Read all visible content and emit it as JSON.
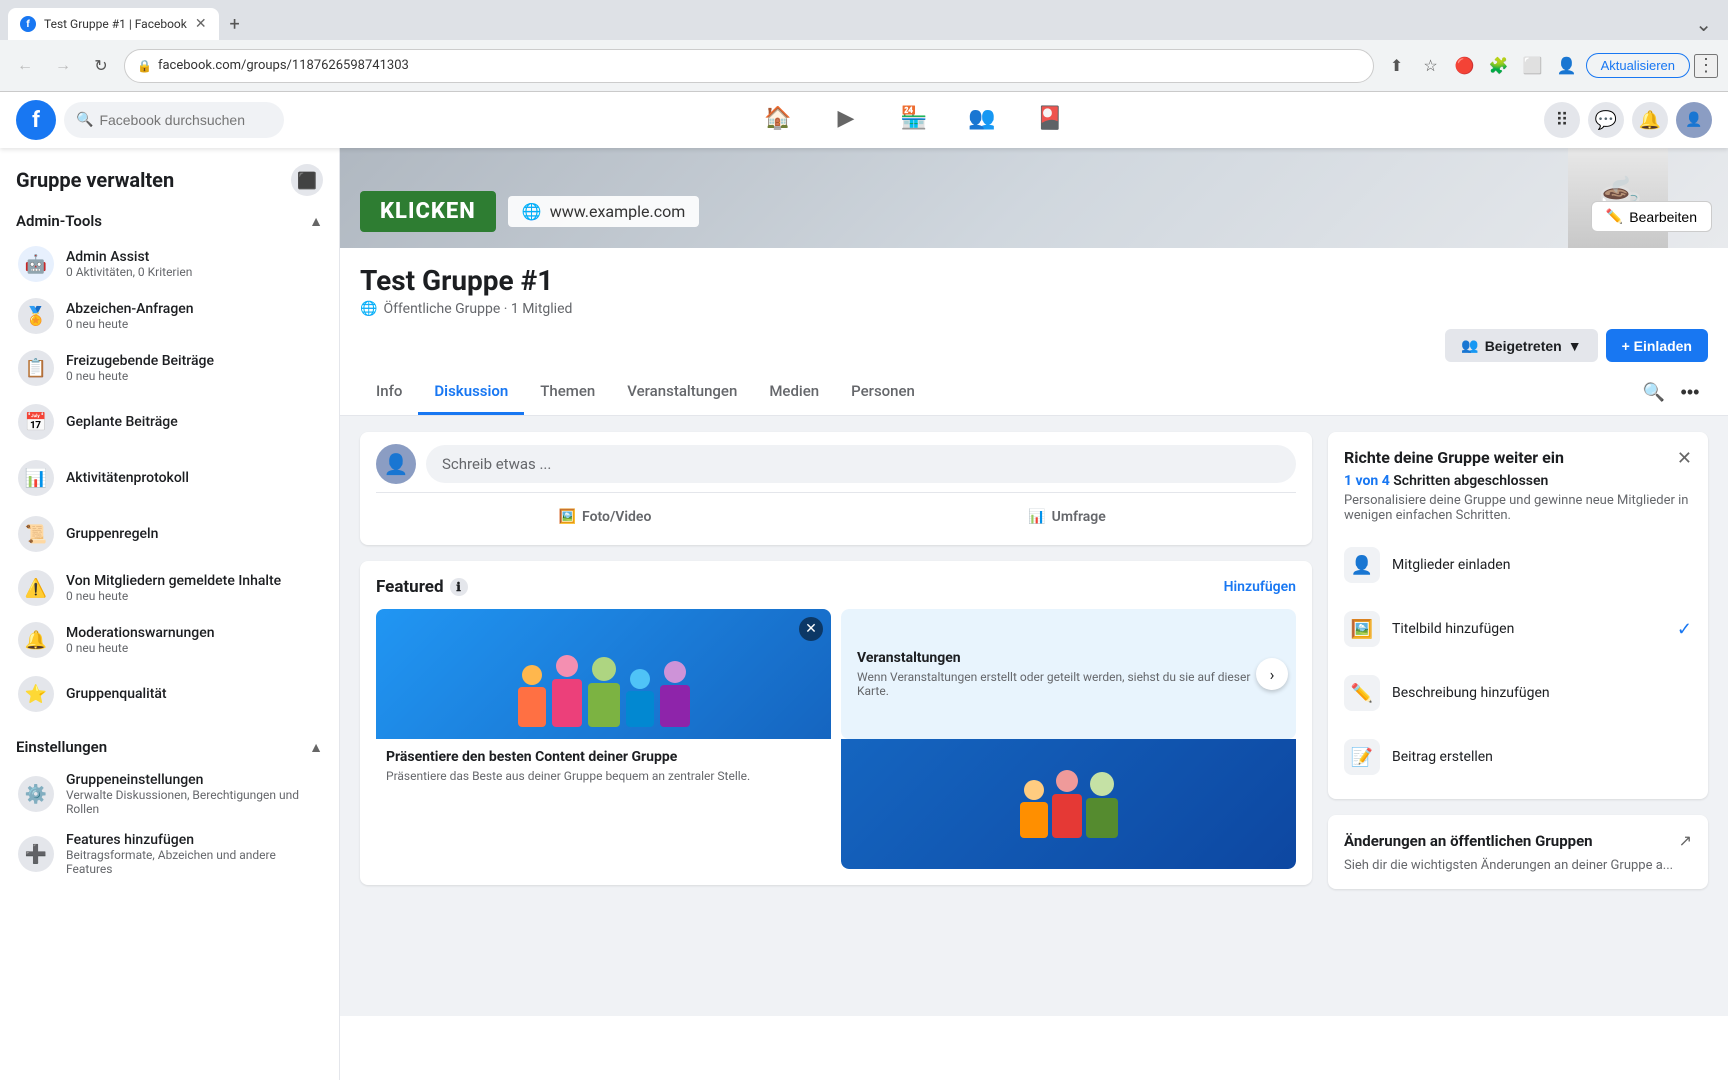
{
  "browser": {
    "tab_title": "Test Gruppe #1 | Facebook",
    "tab_favicon": "f",
    "address": "facebook.com/groups/11876265987413O3",
    "address_display": "facebook.com/groups/1187626598741303",
    "new_tab_label": "+",
    "update_btn_label": "Aktualisieren",
    "nav": {
      "back_disabled": true,
      "forward_disabled": true
    }
  },
  "fb_header": {
    "logo": "f",
    "search_placeholder": "Facebook durchsuchen",
    "nav_items": [
      "🏠",
      "▶",
      "🏪",
      "👥",
      "🎴"
    ],
    "avatar_icon": "👤"
  },
  "sidebar": {
    "title": "Gruppe verwalten",
    "admin_tools_label": "Admin-Tools",
    "items": [
      {
        "id": "admin-assist",
        "icon": "🤖",
        "title": "Admin Assist",
        "sub": "0 Aktivitäten, 0 Kriterien"
      },
      {
        "id": "abzeichen",
        "icon": "🏅",
        "title": "Abzeichen-Anfragen",
        "sub": "0 neu heute"
      },
      {
        "id": "freizugebende",
        "icon": "📋",
        "title": "Freizugebende Beiträge",
        "sub": "0 neu heute"
      },
      {
        "id": "geplante",
        "icon": "📅",
        "title": "Geplante Beiträge",
        "sub": ""
      },
      {
        "id": "aktivitaten",
        "icon": "📊",
        "title": "Aktivitätenprotokoll",
        "sub": ""
      },
      {
        "id": "gruppenregeln",
        "icon": "📜",
        "title": "Gruppenregeln",
        "sub": ""
      },
      {
        "id": "gemeldete",
        "icon": "⚠️",
        "title": "Von Mitgliedern gemeldete Inhalte",
        "sub": "0 neu heute"
      },
      {
        "id": "moderationswarnungen",
        "icon": "🔔",
        "title": "Moderationswarnungen",
        "sub": "0 neu heute"
      },
      {
        "id": "gruppenqualitat",
        "icon": "⭐",
        "title": "Gruppenqualität",
        "sub": ""
      }
    ],
    "einstellungen_label": "Einstellungen",
    "settings_items": [
      {
        "id": "gruppeneinstellungen",
        "icon": "⚙️",
        "title": "Gruppeneinstellungen",
        "sub": "Verwalte Diskussionen, Berechtigungen und Rollen"
      },
      {
        "id": "features",
        "icon": "➕",
        "title": "Features hinzufügen",
        "sub": "Beitragsformate, Abzeichen und andere Features"
      }
    ]
  },
  "group": {
    "cover_klicken": "KLICKEN",
    "cover_url": "www.example.com",
    "cover_edit_label": "Bearbeiten",
    "title": "Test Gruppe #1",
    "visibility_icon": "🌐",
    "meta_text": "Öffentliche Gruppe · 1 Mitglied",
    "btn_joined": "Beigetreten",
    "btn_invite": "+ Einladen",
    "tabs": [
      "Info",
      "Diskussion",
      "Themen",
      "Veranstaltungen",
      "Medien",
      "Personen"
    ],
    "active_tab": "Diskussion"
  },
  "compose": {
    "placeholder": "Schreib etwas ...",
    "action_foto": "Foto/Video",
    "action_umfrage": "Umfrage"
  },
  "featured": {
    "title": "Featured",
    "add_label": "Hinzufügen",
    "card1_title": "Präsentiere den besten Content deiner Gruppe",
    "card1_text": "Präsentiere das Beste aus deiner Gruppe bequem an zentraler Stelle.",
    "card2_title": "Veranstaltungen",
    "card2_text": "Wenn Veranstaltungen erstellt oder geteilt werden, siehst du sie auf dieser Karte."
  },
  "setup_widget": {
    "title": "Richte deine Gruppe weiter ein",
    "progress_label": "1 von 4",
    "progress_text": "Schritten abgeschlossen",
    "description": "Personalisiere deine Gruppe und gewinne neue Mitglieder in wenigen einfachen Schritten.",
    "steps": [
      {
        "id": "mitglieder",
        "icon": "👤",
        "label": "Mitglieder einladen",
        "done": false
      },
      {
        "id": "titelbild",
        "icon": "🖼️",
        "label": "Titelbild hinzufügen",
        "done": true
      },
      {
        "id": "beschreibung",
        "icon": "✏️",
        "label": "Beschreibung hinzufügen",
        "done": false
      },
      {
        "id": "beitrag",
        "icon": "📝",
        "label": "Beitrag erstellen",
        "done": false
      }
    ]
  },
  "changes_widget": {
    "title": "Änderungen an öffentlichen Gruppen",
    "text": "Sieh dir die wichtigsten Änderungen an deiner Gruppe a..."
  }
}
